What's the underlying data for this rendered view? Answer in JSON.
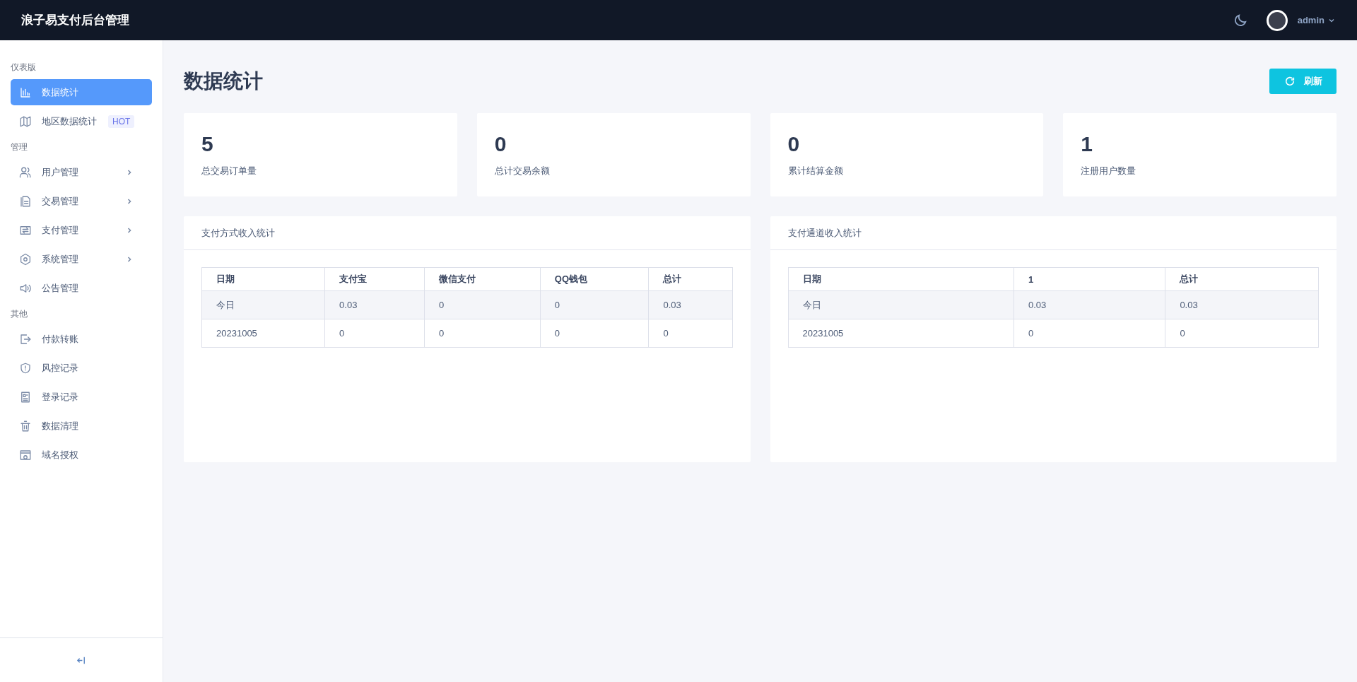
{
  "header": {
    "title": "浪子易支付后台管理",
    "user": "admin"
  },
  "sidebar": {
    "sections": [
      {
        "title": "仪表版",
        "items": [
          {
            "label": "数据统计",
            "selected": true,
            "kind": "link"
          },
          {
            "label": "地区数据统计",
            "selected": false,
            "kind": "link",
            "badge": "HOT"
          }
        ]
      },
      {
        "title": "管理",
        "items": [
          {
            "label": "用户管理",
            "selected": false,
            "kind": "group"
          },
          {
            "label": "交易管理",
            "selected": false,
            "kind": "group"
          },
          {
            "label": "支付管理",
            "selected": false,
            "kind": "group"
          },
          {
            "label": "系统管理",
            "selected": false,
            "kind": "group"
          },
          {
            "label": "公告管理",
            "selected": false,
            "kind": "link"
          }
        ]
      },
      {
        "title": "其他",
        "items": [
          {
            "label": "付款转账",
            "selected": false,
            "kind": "link"
          },
          {
            "label": "风控记录",
            "selected": false,
            "kind": "link"
          },
          {
            "label": "登录记录",
            "selected": false,
            "kind": "link"
          },
          {
            "label": "数据清理",
            "selected": false,
            "kind": "link"
          },
          {
            "label": "域名授权",
            "selected": false,
            "kind": "link"
          }
        ]
      }
    ]
  },
  "page": {
    "title": "数据统计",
    "refresh_button": "刷新"
  },
  "stats": [
    {
      "value": "5",
      "label": "总交易订单量"
    },
    {
      "value": "0",
      "label": "总计交易余额"
    },
    {
      "value": "0",
      "label": "累计结算金额"
    },
    {
      "value": "1",
      "label": "注册用户数量"
    }
  ],
  "panels": [
    {
      "title": "支付方式收入统计",
      "columns": [
        "日期",
        "支付宝",
        "微信支付",
        "QQ钱包",
        "总计"
      ],
      "rows": [
        [
          "今日",
          "0.03",
          "0",
          "0",
          "0.03"
        ],
        [
          "20231005",
          "0",
          "0",
          "0",
          "0"
        ]
      ]
    },
    {
      "title": "支付通道收入统计",
      "columns": [
        "日期",
        "1",
        "总计"
      ],
      "rows": [
        [
          "今日",
          "0.03",
          "0.03"
        ],
        [
          "20231005",
          "0",
          "0"
        ]
      ]
    }
  ]
}
